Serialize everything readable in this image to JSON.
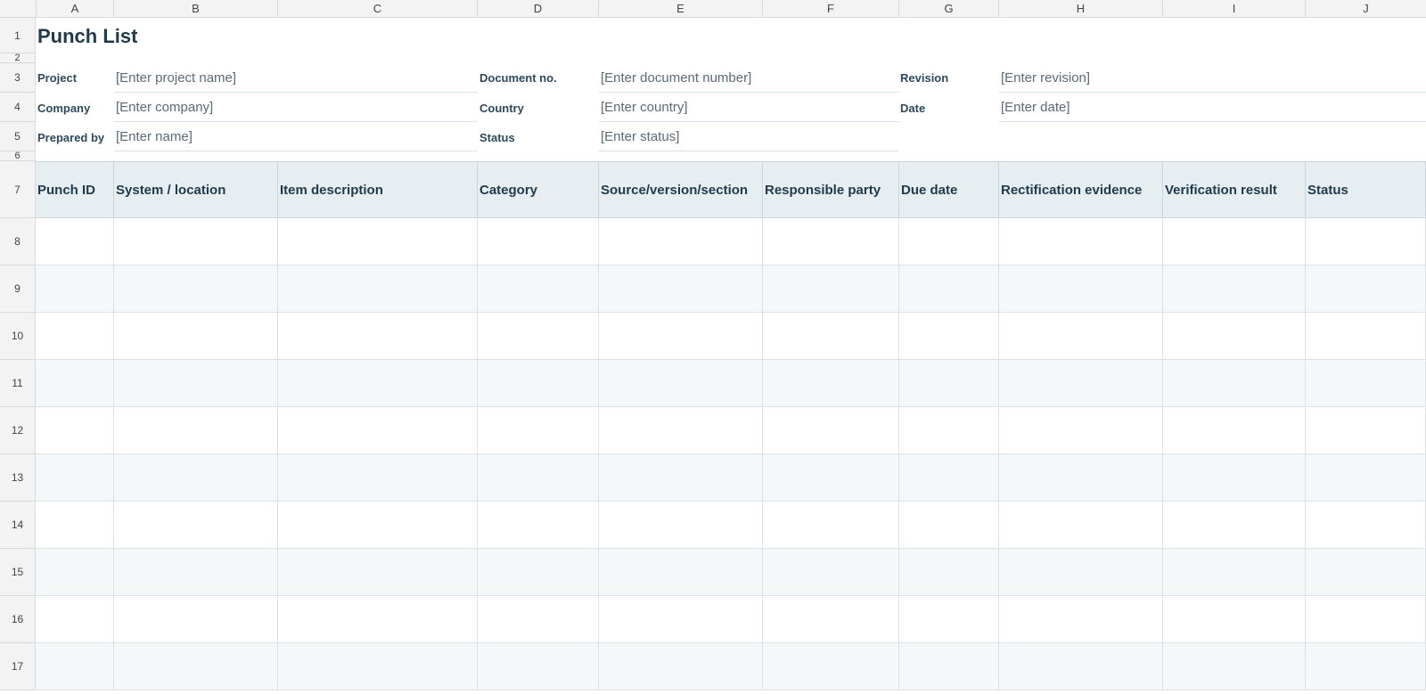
{
  "columns": [
    "A",
    "B",
    "C",
    "D",
    "E",
    "F",
    "G",
    "H",
    "I",
    "J"
  ],
  "row_numbers": [
    "1",
    "2",
    "3",
    "4",
    "5",
    "6",
    "7",
    "8",
    "9",
    "10",
    "11",
    "12",
    "13",
    "14",
    "15",
    "16",
    "17"
  ],
  "title": "Punch List",
  "meta": {
    "project_label": "Project",
    "project_value": "[Enter project name]",
    "docno_label": "Document no.",
    "docno_value": "[Enter document number]",
    "revision_label": "Revision",
    "revision_value": "[Enter revision]",
    "company_label": "Company",
    "company_value": "[Enter company]",
    "country_label": "Country",
    "country_value": "[Enter country]",
    "date_label": "Date",
    "date_value": "[Enter date]",
    "preparedby_label": "Prepared by",
    "preparedby_value": "[Enter name]",
    "status_label": "Status",
    "status_value": "[Enter status]"
  },
  "table_headers": [
    "Punch ID",
    "System / location",
    "Item description",
    "Category",
    "Source/version/section",
    "Responsible party",
    "Due date",
    "Rectification evidence",
    "Verification result",
    "Status"
  ]
}
